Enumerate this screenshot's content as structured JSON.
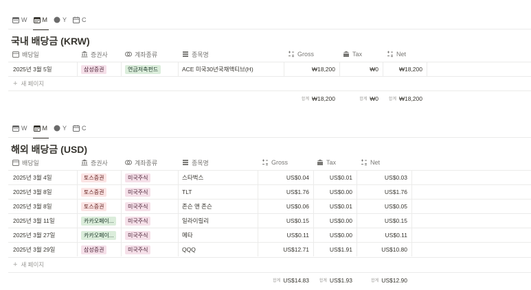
{
  "views": [
    "W",
    "M",
    "Y",
    "C"
  ],
  "krw": {
    "title": "국내 배당금 (KRW)",
    "columns": [
      "배당일",
      "증권사",
      "계좌종류",
      "종목명",
      "Gross",
      "Tax",
      "Net"
    ],
    "rows": [
      {
        "date": "2025년 3월 5일",
        "broker": "삼성증권",
        "account": "연금저축펀드",
        "stock": "ACE 미국30년국채액티브(H)",
        "gross": "₩18,200",
        "tax": "₩0",
        "net": "₩18,200"
      }
    ],
    "new_page": "새 페이지",
    "sum_label": "합계",
    "sums": {
      "gross": "₩18,200",
      "tax": "₩0",
      "net": "₩18,200"
    }
  },
  "usd": {
    "title": "해외 배당금 (USD)",
    "columns": [
      "배당일",
      "증권사",
      "계좌종류",
      "종목명",
      "Gross",
      "Tax",
      "Net"
    ],
    "rows": [
      {
        "date": "2025년 3월 4일",
        "broker": "토스증권",
        "account": "미국주식",
        "stock": "스타벅스",
        "gross": "US$0.04",
        "tax": "US$0.01",
        "net": "US$0.03"
      },
      {
        "date": "2025년 3월 8일",
        "broker": "토스증권",
        "account": "미국주식",
        "stock": "TLT",
        "gross": "US$1.76",
        "tax": "US$0.00",
        "net": "US$1.76"
      },
      {
        "date": "2025년 3월 8일",
        "broker": "토스증권",
        "account": "미국주식",
        "stock": "존슨 앤 존슨",
        "gross": "US$0.06",
        "tax": "US$0.01",
        "net": "US$0.05"
      },
      {
        "date": "2025년 3월 11일",
        "broker": "카카오페이...",
        "account": "미국주식",
        "stock": "일라이릴리",
        "gross": "US$0.15",
        "tax": "US$0.00",
        "net": "US$0.15"
      },
      {
        "date": "2025년 3월 27일",
        "broker": "카카오페이...",
        "account": "미국주식",
        "stock": "메타",
        "gross": "US$0.11",
        "tax": "US$0.00",
        "net": "US$0.11"
      },
      {
        "date": "2025년 3월 29일",
        "broker": "삼성증권",
        "account": "미국주식",
        "stock": "QQQ",
        "gross": "US$12.71",
        "tax": "US$1.91",
        "net": "US$10.80"
      }
    ],
    "new_page": "새 페이지",
    "sum_label": "합계",
    "sums": {
      "gross": "US$14.83",
      "tax": "US$1.93",
      "net": "US$12.90"
    }
  },
  "colors": {
    "samsung": "#f5e0e9",
    "toss": "#fbe4e4",
    "kakao": "#dbeddb",
    "account_pension": "#dbeddb",
    "account_us": "#f5e0e9"
  }
}
